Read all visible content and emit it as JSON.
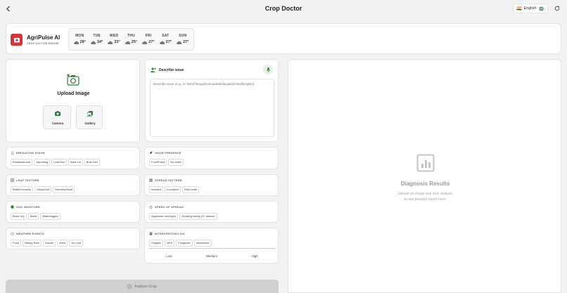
{
  "header": {
    "title": "Crop Doctor",
    "language": "English",
    "flag": "🇮🇳"
  },
  "brand": {
    "name": "AgriPulse AI",
    "subtitle": "CROP DOCTOR ENGINE",
    "color": "#d6343b"
  },
  "weather": [
    {
      "day": "MON",
      "temp": "28°"
    },
    {
      "day": "TUE",
      "temp": "24°"
    },
    {
      "day": "WED",
      "temp": "23°"
    },
    {
      "day": "THU",
      "temp": "25°"
    },
    {
      "day": "FRI",
      "temp": "27°"
    },
    {
      "day": "SAT",
      "temp": "27°"
    },
    {
      "day": "SUN",
      "temp": "27°"
    }
  ],
  "upload": {
    "title": "Upload Image",
    "camera": "Camera",
    "gallery": "Gallery"
  },
  "describe": {
    "title": "Describe issue",
    "placeholder": "Describe issue (e.g., in Tamil/Telugu/Kannada/Malayalam/Hindi/English)"
  },
  "sections": {
    "irrigation": {
      "title": "IRRIGATION STAGE",
      "options": [
        "Establishment",
        "Sprouting",
        "Leaf Dev",
        "Bulb Init",
        "Bulb Dev"
      ]
    },
    "odor": {
      "title": "ODOR PRESENCE",
      "options": [
        "Foul/Putrid",
        "No smell"
      ]
    },
    "leaf": {
      "title": "LEAF TEXTURE",
      "options": [
        "Brittle/Crunchy",
        "Slimy/Soft",
        "Rubbery/Hard"
      ]
    },
    "spread": {
      "title": "SPREAD PATTERN",
      "options": [
        "Isolated",
        "Localized",
        "Field-wide"
      ]
    },
    "soil": {
      "title": "SOIL MOISTURE",
      "options": [
        "Bone Dry",
        "Moist",
        "Waterlogged"
      ]
    },
    "speed": {
      "title": "SPEED OF SPREAD",
      "options": [
        "Appeared overnight",
        "Growing slowly (2+ weeks)"
      ]
    },
    "weatherEvents": {
      "title": "WEATHER EVENTS",
      "options": [
        "Frost",
        "Heavy Rain",
        "Drizzle",
        "Wind",
        "Too Hot"
      ]
    },
    "intervention": {
      "title": "INTERVENTION LOG",
      "options": [
        "Organic",
        "NPK",
        "Fungicide",
        "Insecticide"
      ]
    }
  },
  "levels": [
    "Low",
    "Medium",
    "High"
  ],
  "analyze": {
    "label": "Analyze Crop"
  },
  "results": {
    "title": "Diagnosis Results",
    "line1": "Upload an image and click analyze",
    "line2": "to see detailed report here."
  }
}
